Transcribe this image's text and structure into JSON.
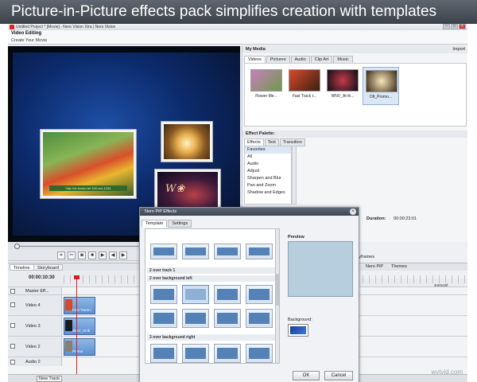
{
  "headline": "Picture-in-Picture effects pack simplifies creation with templates",
  "window": {
    "title": "Untitled Project * [Movie] - Nero Vision Xtra | Nero Vision",
    "section": "Video Editing",
    "subsection": "Create Your Movie"
  },
  "preview": {
    "main_caption": "http://ck.tsuda.net        100-xxx-1234"
  },
  "my_media": {
    "title": "My Media",
    "import_label": "Import",
    "tabs": [
      "Videos",
      "Pictures",
      "Audio",
      "Clip Art",
      "Music"
    ],
    "items": [
      {
        "label": "Flower Me...",
        "color": "#6e9a4e"
      },
      {
        "label": "Fast Track t...",
        "color": "#5a3a2a"
      },
      {
        "label": "WNV_At th...",
        "color": "#1a1a22"
      },
      {
        "label": "Dft_Promo...",
        "color": "#8a7e6e"
      }
    ]
  },
  "effect_palette": {
    "title": "Effect Palette:",
    "tabs": [
      "Effects",
      "Text",
      "Transition"
    ],
    "items": [
      "Favorites",
      "All",
      "Audio",
      "Adjust",
      "Sharpen and Blur",
      "Pan and Zoom",
      "Shadow and Edges"
    ]
  },
  "duration": {
    "label": "Duration:",
    "value": "00:00:23:01"
  },
  "properties": {
    "keyframes_label": "e keyframes"
  },
  "timeline": {
    "tabs": [
      "Timeline",
      "Storyboard"
    ],
    "timecode": "00:00:10:30",
    "nero_pip": "Nero PiP",
    "themes": "Themes",
    "ruler_right": "4m0s16f",
    "tracks": [
      {
        "name": "Master Eff..."
      },
      {
        "name": "Video 4",
        "clip": "Fast Track t"
      },
      {
        "name": "Video 3",
        "clip": "WNV_At th"
      },
      {
        "name": "Video 2",
        "clip": "Promo"
      },
      {
        "name": "Audio 2"
      }
    ],
    "new_track": "New Track"
  },
  "dialog": {
    "title": "Nero PiP Effects",
    "tabs": [
      "Template",
      "Settings"
    ],
    "groups": [
      "2 over track 1",
      "2 over background left",
      "3 over background right"
    ],
    "preview_label": "Preview",
    "background_label": "Background:",
    "ok": "OK",
    "cancel": "Cancel"
  },
  "watermark": "wvtvid.com",
  "colors": {
    "accent": "#5582b6",
    "dialog_titlebar": "#3d4654",
    "playhead": "#d62020"
  }
}
